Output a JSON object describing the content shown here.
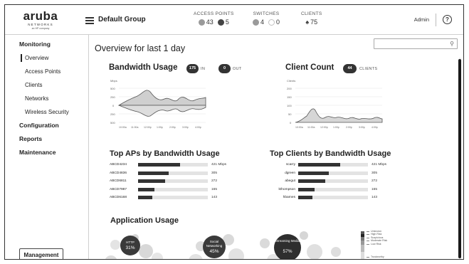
{
  "header": {
    "logo": {
      "word": "aruba",
      "networks": "NETWORKS",
      "company": "an HP company"
    },
    "group_name": "Default Group",
    "access_points": {
      "label": "ACCESS POINTS",
      "up": "43",
      "down": "5"
    },
    "switches": {
      "label": "SWITCHES",
      "up": "4",
      "down": "0"
    },
    "clients": {
      "label": "CLIENTS",
      "count": "75"
    },
    "user": "Admin",
    "help": "?"
  },
  "sidebar": {
    "monitoring": "Monitoring",
    "items": [
      {
        "label": "Overview",
        "active": true
      },
      {
        "label": "Access Points"
      },
      {
        "label": "Clients"
      },
      {
        "label": "Networks"
      },
      {
        "label": "Wireless Security"
      }
    ],
    "configuration": "Configuration",
    "reports": "Reports",
    "maintenance": "Maintenance",
    "management_button": "Management"
  },
  "main": {
    "title": "Overview for last  1 day",
    "search": {
      "placeholder": ""
    },
    "bandwidth": {
      "title": "Bandwidth Usage",
      "in_value": "175",
      "in_label": "IN",
      "out_value": "0",
      "out_label": "OUT",
      "y_unit": "Mbps",
      "y_ticks": [
        "500",
        "250",
        "0",
        "250",
        "500"
      ],
      "x_ticks": [
        "10:00a",
        "11:00a",
        "12:00p",
        "1:00p",
        "2:00p",
        "3:00p",
        "4:00p"
      ]
    },
    "client_count": {
      "title": "Client Count",
      "value": "44",
      "label": "CLIENTS",
      "y_unit": "Clients",
      "y_ticks": [
        "200",
        "150",
        "100",
        "50",
        "0"
      ],
      "x_ticks": [
        "10:00a",
        "11:00a",
        "12:00p",
        "1:00p",
        "2:00p",
        "3:00p",
        "4:00p"
      ]
    },
    "top_aps": {
      "title": "Top APs by Bandwidth Usage",
      "max": 421,
      "rows": [
        {
          "name": "ABCD4234",
          "value": 421,
          "label": "421  Mbps"
        },
        {
          "name": "ABCD4836",
          "value": 305,
          "label": "305"
        },
        {
          "name": "ABCD6811",
          "value": 272,
          "label": "272"
        },
        {
          "name": "ABCD7987",
          "value": 165,
          "label": "165"
        },
        {
          "name": "ABCD6168",
          "value": 143,
          "label": "143"
        }
      ]
    },
    "top_clients": {
      "title": "Top Clients by Bandwidth Usage",
      "max": 421,
      "rows": [
        {
          "name": "scarry",
          "value": 421,
          "label": "421  Mbps"
        },
        {
          "name": "dgreen",
          "value": 305,
          "label": "305"
        },
        {
          "name": "abegut",
          "value": 272,
          "label": "272"
        },
        {
          "name": "kthompson",
          "value": 165,
          "label": "165"
        },
        {
          "name": "hbarnes",
          "value": 143,
          "label": "143"
        }
      ]
    },
    "application_usage": {
      "title": "Application Usage",
      "bubbles": [
        {
          "label": "HTTP",
          "pct": "31%"
        },
        {
          "label": "Social Networking",
          "pct": "45%"
        },
        {
          "label": "Streaming Media",
          "pct": "57%"
        }
      ],
      "risk_legend": [
        "Unknown",
        "High Risk",
        "Suspicious",
        "Moderate Risk",
        "Low Risk",
        "Trustworthy"
      ]
    }
  },
  "colors": {
    "dark": "#333333",
    "bar_track": "#e3e3e3",
    "bubble": "#d4d4d4"
  }
}
